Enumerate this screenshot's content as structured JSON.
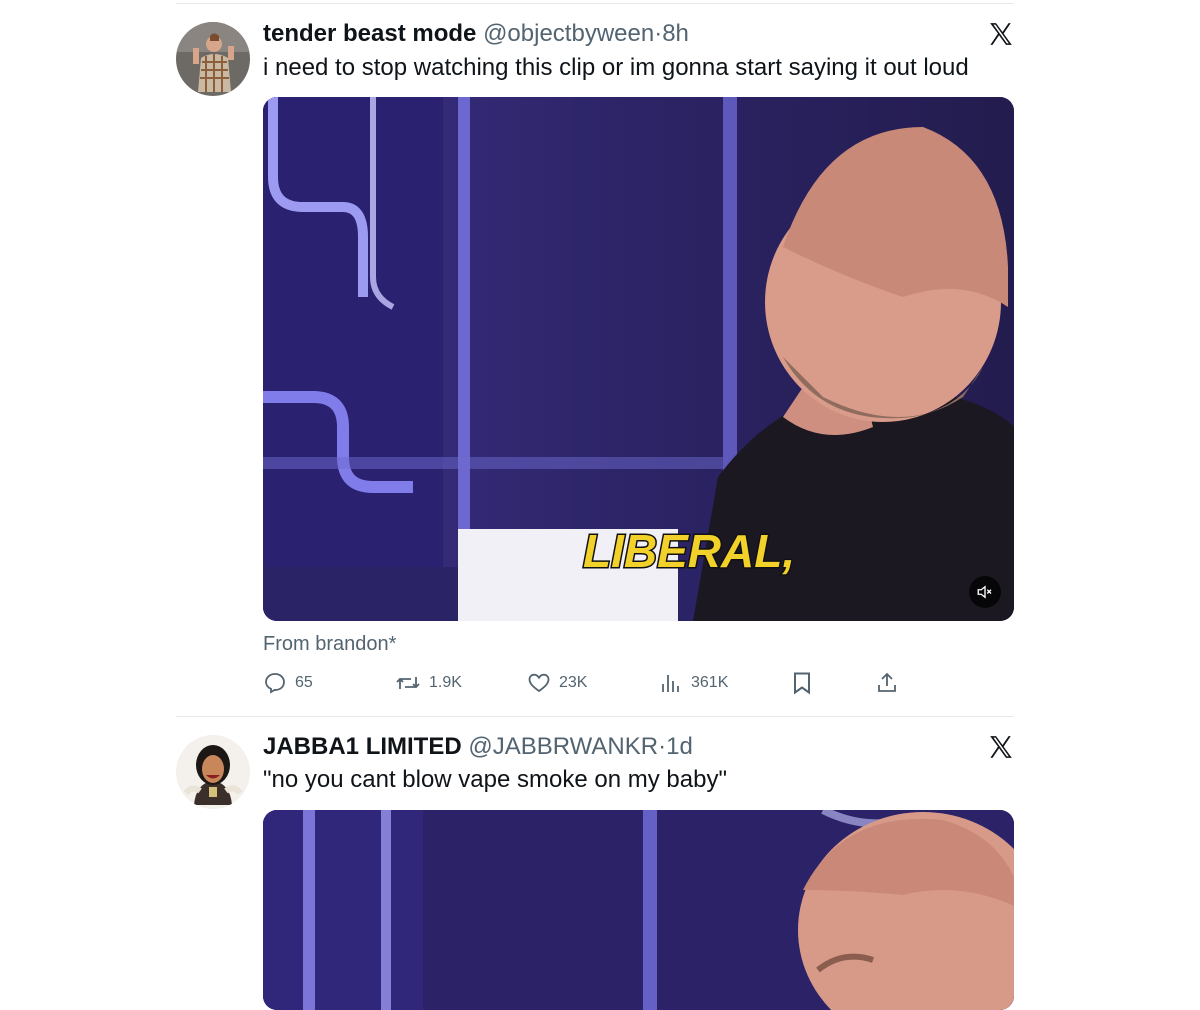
{
  "tweets": [
    {
      "display_name": "tender beast mode",
      "handle": "@objectbyween",
      "separator": "·",
      "time": "8h",
      "text": "i need to stop watching this clip or im gonna start saying it out loud",
      "media": {
        "caption": "LIBERAL,",
        "muted_icon": "speaker-muted-icon"
      },
      "from_label": "From brandon*",
      "actions": {
        "replies": "65",
        "reposts": "1.9K",
        "likes": "23K",
        "views": "361K"
      }
    },
    {
      "display_name": "JABBA1 LIMITED",
      "handle": "@JABBRWANKR",
      "separator": "·",
      "time": "1d",
      "text": "\"no you cant blow vape smoke on my baby\""
    }
  ],
  "icons": [
    "x-logo-icon",
    "reply-icon",
    "repost-icon",
    "like-icon",
    "views-icon",
    "bookmark-icon",
    "share-icon",
    "speaker-muted-icon"
  ],
  "colors": {
    "text_primary": "#0f1419",
    "text_secondary": "#536471",
    "divider": "#e6e9ec",
    "caption_yellow": "#f2d12b"
  }
}
